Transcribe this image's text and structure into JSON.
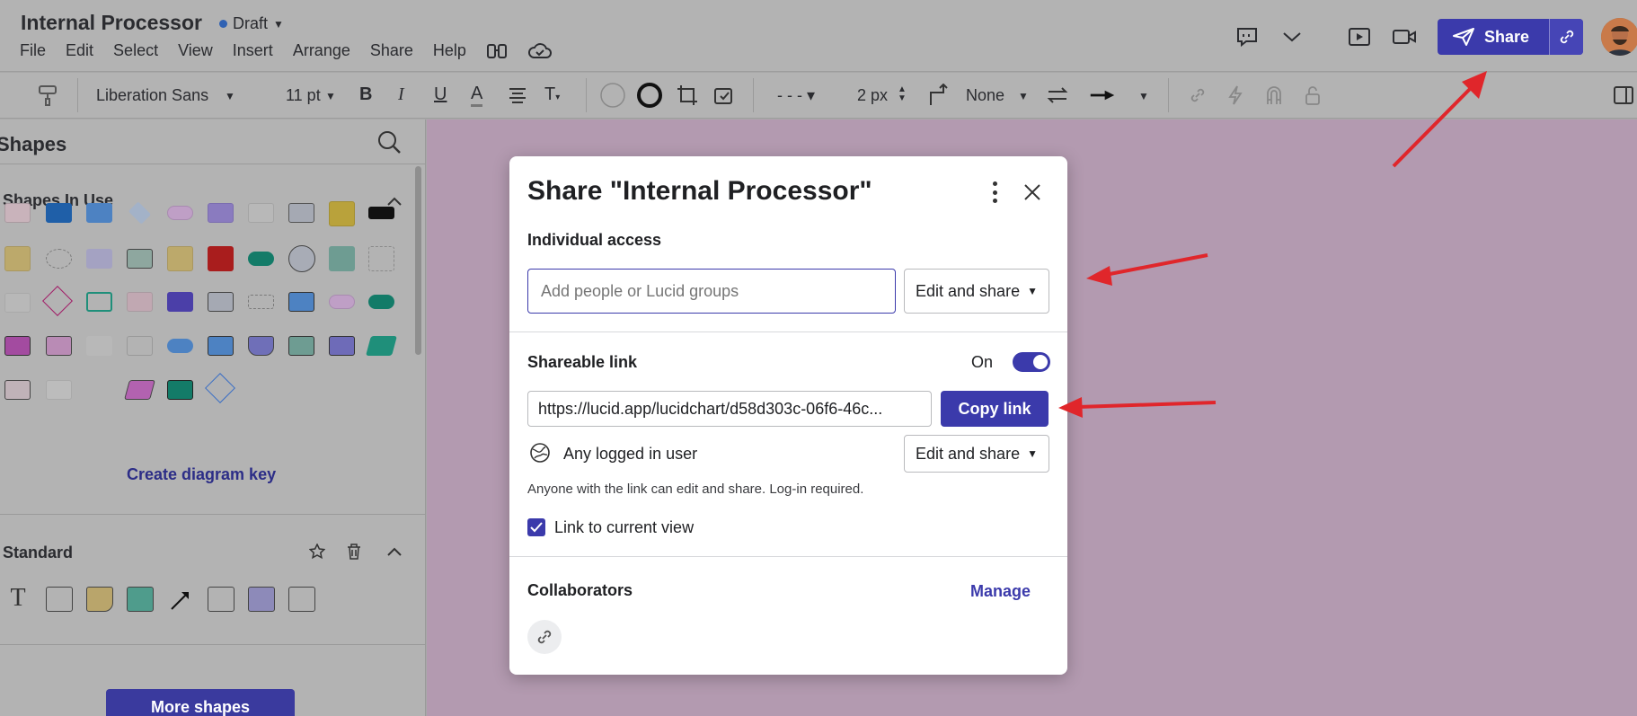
{
  "header": {
    "title": "Internal Processor",
    "status": "Draft",
    "menu": [
      "File",
      "Edit",
      "Select",
      "View",
      "Insert",
      "Arrange",
      "Share",
      "Help"
    ],
    "share_label": "Share"
  },
  "toolbar": {
    "font": "Liberation Sans",
    "font_size": "11 pt",
    "line_width": "2 px",
    "line_end": "None"
  },
  "sidebar": {
    "title": "Shapes",
    "section_in_use": "Shapes In Use",
    "create_key": "Create diagram key",
    "section_standard": "Standard",
    "more_shapes": "More shapes"
  },
  "modal": {
    "title": "Share \"Internal Processor\"",
    "individual_access": "Individual access",
    "add_people_placeholder": "Add people or Lucid groups",
    "access_level": "Edit and share",
    "shareable_link": "Shareable link",
    "toggle_state": "On",
    "link_url": "https://lucid.app/lucidchart/d58d303c-06f6-46c...",
    "copy_link": "Copy link",
    "link_audience": "Any logged in user",
    "link_access_level": "Edit and share",
    "link_note": "Anyone with the link can edit and share. Log-in required.",
    "link_to_view": "Link to current view",
    "collaborators": "Collaborators",
    "manage": "Manage"
  },
  "colors": {
    "accent": "#3b3aab",
    "canvas": "#b39ab0",
    "arrow": "#e0262b"
  }
}
